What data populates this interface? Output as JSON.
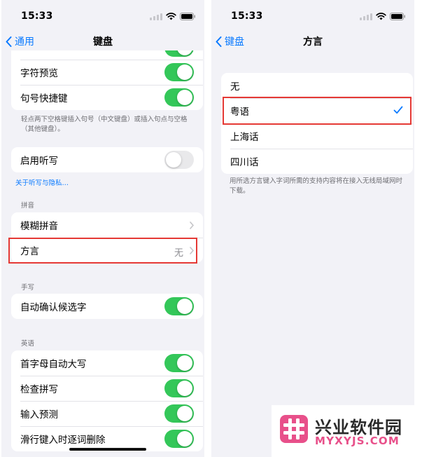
{
  "status": {
    "time": "15:33"
  },
  "left": {
    "nav": {
      "back": "通用",
      "title": "键盘"
    },
    "top_group": {
      "items": [
        {
          "label": "字符预览",
          "toggle": true
        },
        {
          "label": "句号快捷键",
          "toggle": true
        }
      ]
    },
    "period_note": "轻点两下空格键插入句号（中文键盘）或插入句点与空格（其他键盘）。",
    "dictation": {
      "label": "启用听写",
      "toggle": false
    },
    "privacy_link": "关于听写与隐私…",
    "pinyin": {
      "header": "拼音",
      "fuzzy": "模糊拼音",
      "dialect": "方言",
      "dialect_value": "无"
    },
    "handwriting": {
      "header": "手写",
      "auto_confirm": "自动确认候选字"
    },
    "english": {
      "header": "英语",
      "items": [
        {
          "label": "首字母自动大写",
          "toggle": true
        },
        {
          "label": "检查拼写",
          "toggle": true
        },
        {
          "label": "输入预测",
          "toggle": true
        },
        {
          "label": "滑行键入时逐词删除",
          "toggle": true
        }
      ]
    }
  },
  "right": {
    "nav": {
      "back": "键盘",
      "title": "方言"
    },
    "options": [
      "无",
      "粤语",
      "上海话",
      "四川话"
    ],
    "selected": "粤语",
    "note": "用所选方言键入字词所需的支持内容将在接入无线局域网时下载。"
  },
  "watermark": {
    "title": "兴业软件园",
    "subtitle": "MYXYJS.COM"
  },
  "colors": {
    "accent": "#0a7aff",
    "toggle_on": "#34c759",
    "highlight": "#e53935",
    "watermark_pink": "#e8508a"
  }
}
